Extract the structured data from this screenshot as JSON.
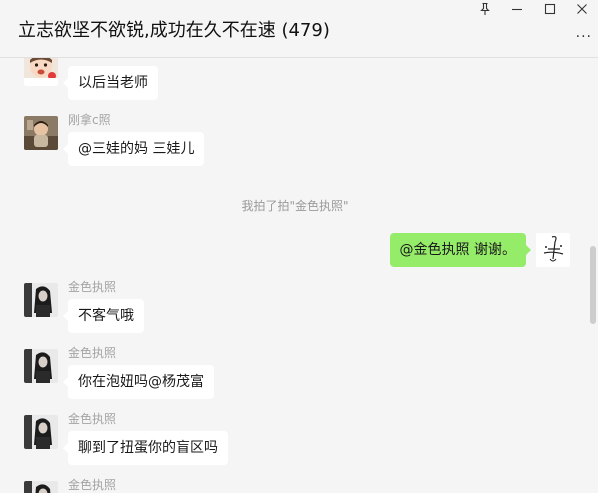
{
  "window": {
    "title": "立志欲坚不欲锐,成功在久不在速 (479)",
    "more_label": "···",
    "icons": [
      "pin-icon",
      "minimize-icon",
      "maximize-icon",
      "close-icon"
    ]
  },
  "messages": [
    {
      "type": "left",
      "sender": "",
      "text": "以后当老师"
    },
    {
      "type": "left",
      "sender": "刚拿c照",
      "text": "@三娃的妈 三娃儿"
    },
    {
      "type": "system",
      "text": "我拍了拍\"金色执照\""
    },
    {
      "type": "right",
      "text": "@金色执照 谢谢。"
    },
    {
      "type": "left",
      "sender": "金色执照",
      "text": "不客气哦"
    },
    {
      "type": "left",
      "sender": "金色执照",
      "text": "你在泡妞吗@杨茂富"
    },
    {
      "type": "left",
      "sender": "金色执照",
      "text": "聊到了扭蛋你的盲区吗"
    },
    {
      "type": "left",
      "sender": "金色执照",
      "text": ""
    }
  ],
  "colors": {
    "background": "#f5f5f5",
    "bubble_self": "#95ec69",
    "bubble_other": "#ffffff",
    "nickname": "#a3a3a3"
  }
}
